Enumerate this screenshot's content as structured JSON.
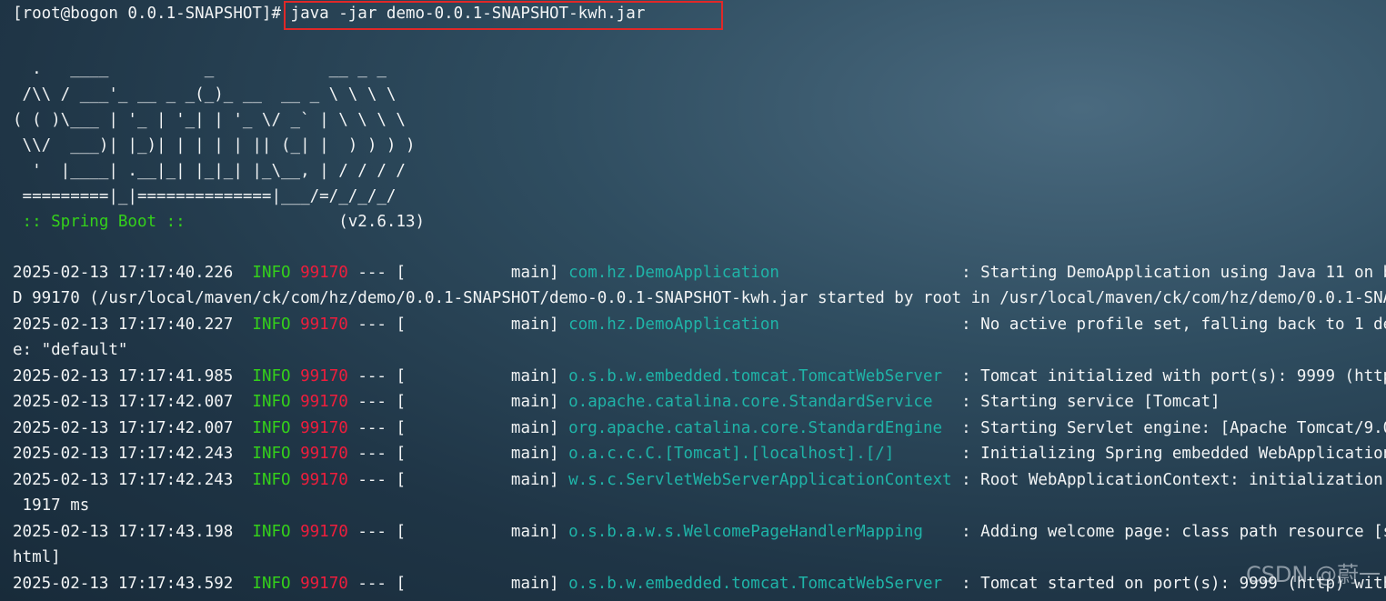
{
  "terminal": {
    "prompt": "[root@bogon 0.0.1-SNAPSHOT]# ",
    "command": "java -jar demo-0.0.1-SNAPSHOT-kwh.jar",
    "banner": [
      "  .   ____          _            __ _ _",
      " /\\\\ / ___'_ __ _ _(_)_ __  __ _ \\ \\ \\ \\",
      "( ( )\\___ | '_ | '_| | '_ \\/ _` | \\ \\ \\ \\",
      " \\\\/  ___)| |_)| | | | | || (_| |  ) ) ) )",
      "  '  |____| .__|_| |_|_| |_\\__, | / / / /",
      " =========|_|==============|___/=/_/_/_/"
    ],
    "spring_label": " :: Spring Boot :: ",
    "spring_version": "               (v2.6.13)",
    "logs": [
      {
        "ts": "2025-02-13 17:17:40.226  ",
        "level": "INFO",
        "pid": "99170",
        "thread": " --- [           main] ",
        "logger": "com.hz.DemoApplication                  ",
        "msg": " : Starting DemoApplication using Java 11 on b"
      },
      {
        "cont": "D 99170 (/usr/local/maven/ck/com/hz/demo/0.0.1-SNAPSHOT/demo-0.0.1-SNAPSHOT-kwh.jar started by root in /usr/local/maven/ck/com/hz/demo/0.0.1-SNA"
      },
      {
        "ts": "2025-02-13 17:17:40.227  ",
        "level": "INFO",
        "pid": "99170",
        "thread": " --- [           main] ",
        "logger": "com.hz.DemoApplication                  ",
        "msg": " : No active profile set, falling back to 1 de"
      },
      {
        "cont": "e: \"default\""
      },
      {
        "ts": "2025-02-13 17:17:41.985  ",
        "level": "INFO",
        "pid": "99170",
        "thread": " --- [           main] ",
        "logger": "o.s.b.w.embedded.tomcat.TomcatWebServer ",
        "msg": " : Tomcat initialized with port(s): 9999 (http"
      },
      {
        "ts": "2025-02-13 17:17:42.007  ",
        "level": "INFO",
        "pid": "99170",
        "thread": " --- [           main] ",
        "logger": "o.apache.catalina.core.StandardService  ",
        "msg": " : Starting service [Tomcat]"
      },
      {
        "ts": "2025-02-13 17:17:42.007  ",
        "level": "INFO",
        "pid": "99170",
        "thread": " --- [           main] ",
        "logger": "org.apache.catalina.core.StandardEngine ",
        "msg": " : Starting Servlet engine: [Apache Tomcat/9.0"
      },
      {
        "ts": "2025-02-13 17:17:42.243  ",
        "level": "INFO",
        "pid": "99170",
        "thread": " --- [           main] ",
        "logger": "o.a.c.c.C.[Tomcat].[localhost].[/]      ",
        "msg": " : Initializing Spring embedded WebApplication"
      },
      {
        "ts": "2025-02-13 17:17:42.243  ",
        "level": "INFO",
        "pid": "99170",
        "thread": " --- [           main] ",
        "logger": "w.s.c.ServletWebServerApplicationContext",
        "msg": " : Root WebApplicationContext: initialization "
      },
      {
        "cont": " 1917 ms"
      },
      {
        "ts": "2025-02-13 17:17:43.198  ",
        "level": "INFO",
        "pid": "99170",
        "thread": " --- [           main] ",
        "logger": "o.s.b.a.w.s.WelcomePageHandlerMapping   ",
        "msg": " : Adding welcome page: class path resource [s"
      },
      {
        "cont": "html]"
      },
      {
        "ts": "2025-02-13 17:17:43.592  ",
        "level": "INFO",
        "pid": "99170",
        "thread": " --- [           main] ",
        "logger": "o.s.b.w.embedded.tomcat.TomcatWebServer ",
        "msg": " : Tomcat started on port(s): 9999 (http) with"
      }
    ]
  },
  "watermark": "CSDN @蔚一",
  "colors": {
    "level": "#34d11a",
    "pid": "#ef1d3c",
    "logger": "#1fb4a8",
    "highlight_box": "#e02828"
  }
}
